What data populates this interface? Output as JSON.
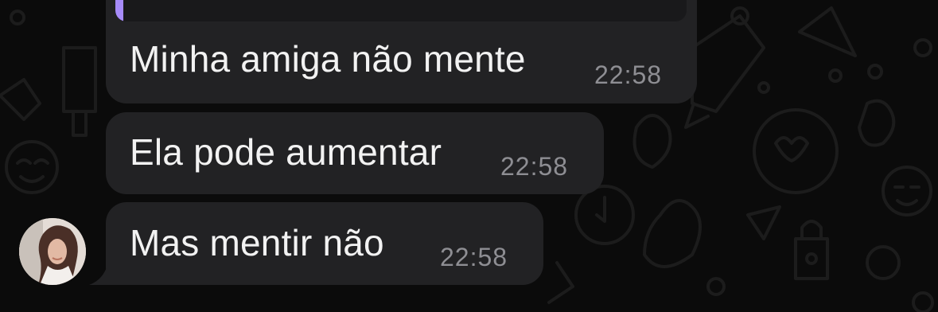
{
  "conversation": {
    "messages": [
      {
        "text": "Minha amiga não mente",
        "time": "22:58",
        "has_reply_quote": true
      },
      {
        "text": "Ela pode aumentar",
        "time": "22:58",
        "has_reply_quote": false
      },
      {
        "text": "Mas mentir não",
        "time": "22:58",
        "has_reply_quote": false
      }
    ],
    "sender_avatar": "contact-avatar"
  },
  "colors": {
    "background": "#0b0b0b",
    "bubble": "#222224",
    "quote_accent": "#a78bfa",
    "text": "#f2f2f2",
    "timestamp": "#8e8e93"
  },
  "icons": [
    "doodle-wallpaper-pattern"
  ]
}
